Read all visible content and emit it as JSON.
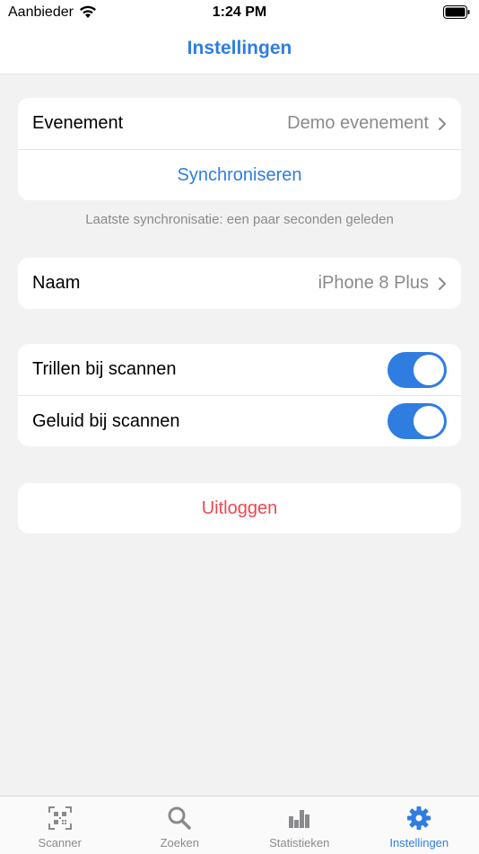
{
  "status_bar": {
    "carrier": "Aanbieder",
    "time": "1:24 PM"
  },
  "nav": {
    "title": "Instellingen"
  },
  "event_section": {
    "event_label": "Evenement",
    "event_value": "Demo evenement",
    "sync_label": "Synchroniseren",
    "last_sync": "Laatste synchronisatie: een paar seconden geleden"
  },
  "device_section": {
    "name_label": "Naam",
    "name_value": "iPhone 8 Plus"
  },
  "toggles": [
    {
      "label": "Trillen bij scannen",
      "on": true
    },
    {
      "label": "Geluid bij scannen",
      "on": true
    }
  ],
  "logout_label": "Uitloggen",
  "tabbar": {
    "items": [
      {
        "label": "Scanner",
        "icon": "qr-code-icon",
        "active": false
      },
      {
        "label": "Zoeken",
        "icon": "search-icon",
        "active": false
      },
      {
        "label": "Statistieken",
        "icon": "bar-chart-icon",
        "active": false
      },
      {
        "label": "Instellingen",
        "icon": "gear-icon",
        "active": true
      }
    ]
  },
  "colors": {
    "accent": "#2f7de1",
    "destructive": "#f0464f",
    "background": "#f2f2f2"
  }
}
